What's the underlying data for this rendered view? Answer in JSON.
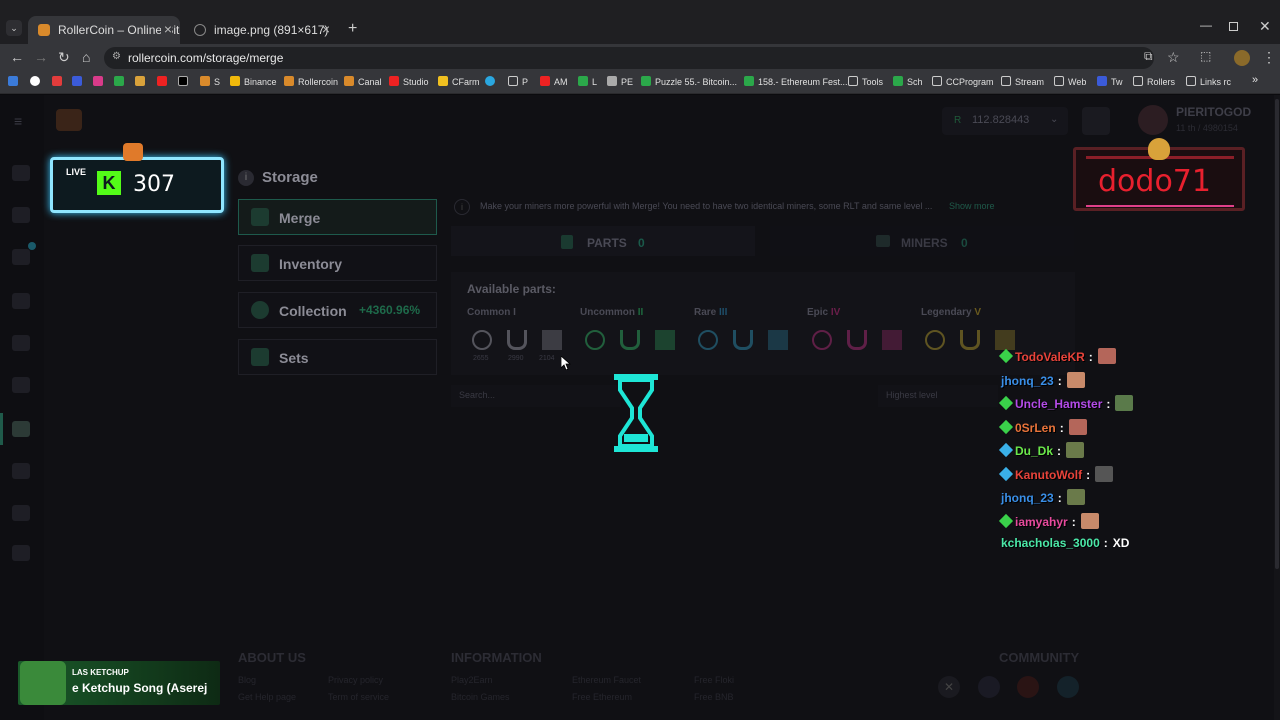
{
  "browser": {
    "tabs": [
      {
        "title": "RollerCoin – Online Bitcoin Mi",
        "close": "×"
      },
      {
        "title": "image.png (891×617)",
        "close": "×"
      }
    ],
    "new_tab": "+",
    "url": "rollercoin.com/storage/merge",
    "bookmarks": [
      "S",
      "Binance",
      "Rollercoin",
      "Canal",
      "Studio",
      "CFarm",
      "P",
      "AM",
      "L",
      "PE",
      "Puzzle 55.- Bitcoin...",
      "158.- Ethereum Fest...",
      "Tools",
      "Sch",
      "CCProgram",
      "Stream",
      "Web",
      "Tw",
      "Rollers",
      "Links rc"
    ]
  },
  "header": {
    "balance": "112.828443",
    "username": "PIERITOGOD",
    "rank": "11 th / 4980154"
  },
  "storage": {
    "title": "Storage",
    "menu": [
      {
        "label": "Merge"
      },
      {
        "label": "Inventory"
      },
      {
        "label": "Collection",
        "badge": "+4360.96%"
      },
      {
        "label": "Sets"
      }
    ]
  },
  "merge": {
    "info": "Make your miners more powerful with Merge! You need to have two identical miners, some RLT and same level ...",
    "show_more": "Show more",
    "tabs": [
      {
        "label": "PARTS",
        "count": "0"
      },
      {
        "label": "MINERS",
        "count": "0"
      }
    ],
    "available_title": "Available parts:",
    "rarities": [
      {
        "name": "Common",
        "level": "I",
        "color": "#8a8a95"
      },
      {
        "name": "Uncommon",
        "level": "II",
        "color": "#2e9e5b"
      },
      {
        "name": "Rare",
        "level": "III",
        "color": "#2a7f9e"
      },
      {
        "name": "Epic",
        "level": "IV",
        "color": "#9e2a6e"
      },
      {
        "name": "Legendary",
        "level": "V",
        "color": "#9e8a2a"
      }
    ],
    "common_counts": [
      "2655",
      "2990",
      "2104"
    ],
    "search_placeholder": "Search...",
    "sort": "Highest level"
  },
  "footer": {
    "about": "ABOUT US",
    "information": "INFORMATION",
    "community": "COMMUNITY",
    "about_links": [
      "Blog",
      "Privacy policy",
      "Get Help page",
      "Term of service"
    ],
    "info_links": [
      "Play2Earn",
      "Ethereum Faucet",
      "Free Floki",
      "Bitcoin Games",
      "Free Ethereum",
      "Free BNB"
    ]
  },
  "overlay": {
    "live": "LIVE",
    "kick_count": "307",
    "streamer": "dodo71",
    "music_artist": "LAS KETCHUP",
    "music_title": "e Ketchup Song (Aserej",
    "chat": [
      {
        "user": "TodoValeKR",
        "sep": ":",
        "color": "#e8433a"
      },
      {
        "user": "jhonq_23",
        "sep": ":",
        "color": "#3a8fe8"
      },
      {
        "user": "Uncle_Hamster",
        "sep": ":",
        "color": "#b44be8"
      },
      {
        "user": "0SrLen",
        "sep": ":",
        "color": "#e8733a"
      },
      {
        "user": "Du_Dk",
        "sep": ":",
        "color": "#6be84b"
      },
      {
        "user": "KanutoWolf",
        "sep": ":",
        "color": "#e8433a"
      },
      {
        "user": "jhonq_23",
        "sep": ":",
        "color": "#3a8fe8"
      },
      {
        "user": "iamyahyr",
        "sep": ":",
        "color": "#e84b9e"
      },
      {
        "user": "kchacholas_3000",
        "sep": ":",
        "color": "#4be8a8",
        "msg": "XD"
      }
    ]
  }
}
